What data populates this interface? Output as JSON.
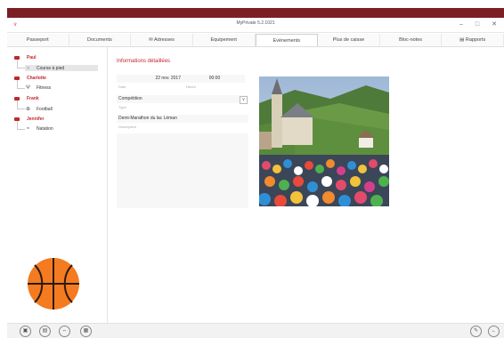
{
  "window": {
    "title": "MyPrivate 5.2.1021",
    "minimize": "–",
    "maximize": "□",
    "close": "✕"
  },
  "tabs": [
    {
      "label": "Passeport"
    },
    {
      "label": "Documents"
    },
    {
      "label": "✉ Adresses"
    },
    {
      "label": "Equipement"
    },
    {
      "label": "Evénements",
      "active": true
    },
    {
      "label": "Plus de caisse"
    },
    {
      "label": "Bloc-notes"
    },
    {
      "label": "▤ Rapports"
    }
  ],
  "tree": [
    {
      "name": "Paul",
      "child": {
        "label": "Course à pied",
        "icon": "○",
        "selected": true
      }
    },
    {
      "name": "Charlotte",
      "child": {
        "label": "Fitness",
        "icon": "Ψ"
      }
    },
    {
      "name": "Frank",
      "child": {
        "label": "Football",
        "icon": "⊕"
      }
    },
    {
      "name": "Jennifer",
      "child": {
        "label": "Natation",
        "icon": "≈"
      }
    }
  ],
  "details": {
    "section_title": "Informations détaillées",
    "date_value": "22 nov. 2017",
    "date_label": "Date",
    "time_value": "00:00",
    "time_label": "Heure",
    "type_value": "Compétition",
    "type_label": "Type",
    "type_arrow": "∨",
    "description_value": "Demi-Marathon du lac Léman",
    "description_label": "Description"
  },
  "bottom": {
    "left_buttons": [
      "▣",
      "▤",
      "⇔",
      "▦"
    ],
    "right_buttons": [
      "✎",
      "←"
    ]
  }
}
